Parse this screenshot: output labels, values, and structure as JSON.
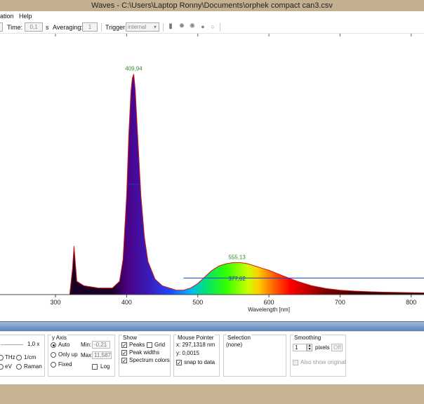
{
  "window": {
    "title": "Waves  -  C:\\Users\\Laptop Ronny\\Documents\\orphek compact can3.csv"
  },
  "menu": {
    "items": [
      "ation",
      "Help"
    ]
  },
  "toolbar": {
    "time_label": "Time:",
    "time_value": "0,1",
    "time_unit": "s",
    "averaging_label": "Averaging:",
    "averaging_value": "1",
    "trigger_label": "Trigger:",
    "trigger_value": "internal",
    "icons": [
      "save-icon",
      "sun-icon",
      "sun-outline-icon",
      "record-icon",
      "stop-icon"
    ]
  },
  "chart_data": {
    "type": "area",
    "xlabel": "Wavelength [nm]",
    "x_ticks": [
      "300",
      "400",
      "500",
      "600",
      "700",
      "800"
    ],
    "xlim": [
      222,
      818
    ],
    "ylim": [
      0,
      1.1
    ],
    "spectrum_colors": true,
    "peak_labels": [
      {
        "text": "409,94",
        "x": 409.94,
        "color": "#2e8b2e"
      },
      {
        "text": "555,13",
        "x": 555.13,
        "color": "#2e8b2e"
      }
    ],
    "width_labels": [
      {
        "text": "377,62",
        "x": 555.13,
        "color": "#1a3bd6"
      }
    ],
    "series": [
      {
        "x": [
          222,
          320,
          324,
          326,
          330,
          340,
          360,
          380,
          390,
          395,
          400,
          403,
          406,
          408,
          410,
          412,
          415,
          420,
          425,
          430,
          440,
          450,
          460,
          470,
          480,
          490,
          500,
          510,
          520,
          530,
          540,
          550,
          560,
          570,
          580,
          590,
          600,
          620,
          640,
          660,
          680,
          700,
          720,
          740,
          760,
          780,
          800,
          818
        ],
        "y": [
          0,
          0,
          0.12,
          0.22,
          0.06,
          0.04,
          0.03,
          0.03,
          0.06,
          0.16,
          0.45,
          0.72,
          0.92,
          0.98,
          1.0,
          0.93,
          0.75,
          0.45,
          0.26,
          0.15,
          0.07,
          0.04,
          0.03,
          0.02,
          0.02,
          0.03,
          0.05,
          0.08,
          0.11,
          0.13,
          0.14,
          0.145,
          0.145,
          0.14,
          0.13,
          0.12,
          0.11,
          0.085,
          0.06,
          0.04,
          0.028,
          0.02,
          0.016,
          0.013,
          0.011,
          0.01,
          0.009,
          0.008
        ]
      }
    ]
  },
  "panel": {
    "zoom_value": "1,0 x",
    "units": {
      "thz": "THz",
      "cm": "1/cm",
      "ev": "eV",
      "raman": "Raman"
    },
    "yaxis": {
      "title": "y Axis",
      "auto": "Auto",
      "only_up": "Only up",
      "fixed": "Fixed",
      "min_label": "Min:",
      "min_value": "-0,21",
      "max_label": "Max:",
      "max_value": "11,587",
      "log_label": "Log"
    },
    "show": {
      "title": "Show",
      "peaks": "Peaks",
      "grid": "Grid",
      "peak_widths": "Peak widths",
      "spectrum_colors": "Spectrum colors"
    },
    "mouse": {
      "title": "Mouse Pointer",
      "x": "x: 297,1318 nm",
      "y": "y: 0,0015",
      "snap": "snap to data"
    },
    "selection": {
      "title": "Selection",
      "value": "(none)"
    },
    "smoothing": {
      "title": "Smoothing",
      "pixels_value": "1",
      "pixels_label": "pixels",
      "off_label": "Off",
      "also_show": "Also show original"
    }
  }
}
